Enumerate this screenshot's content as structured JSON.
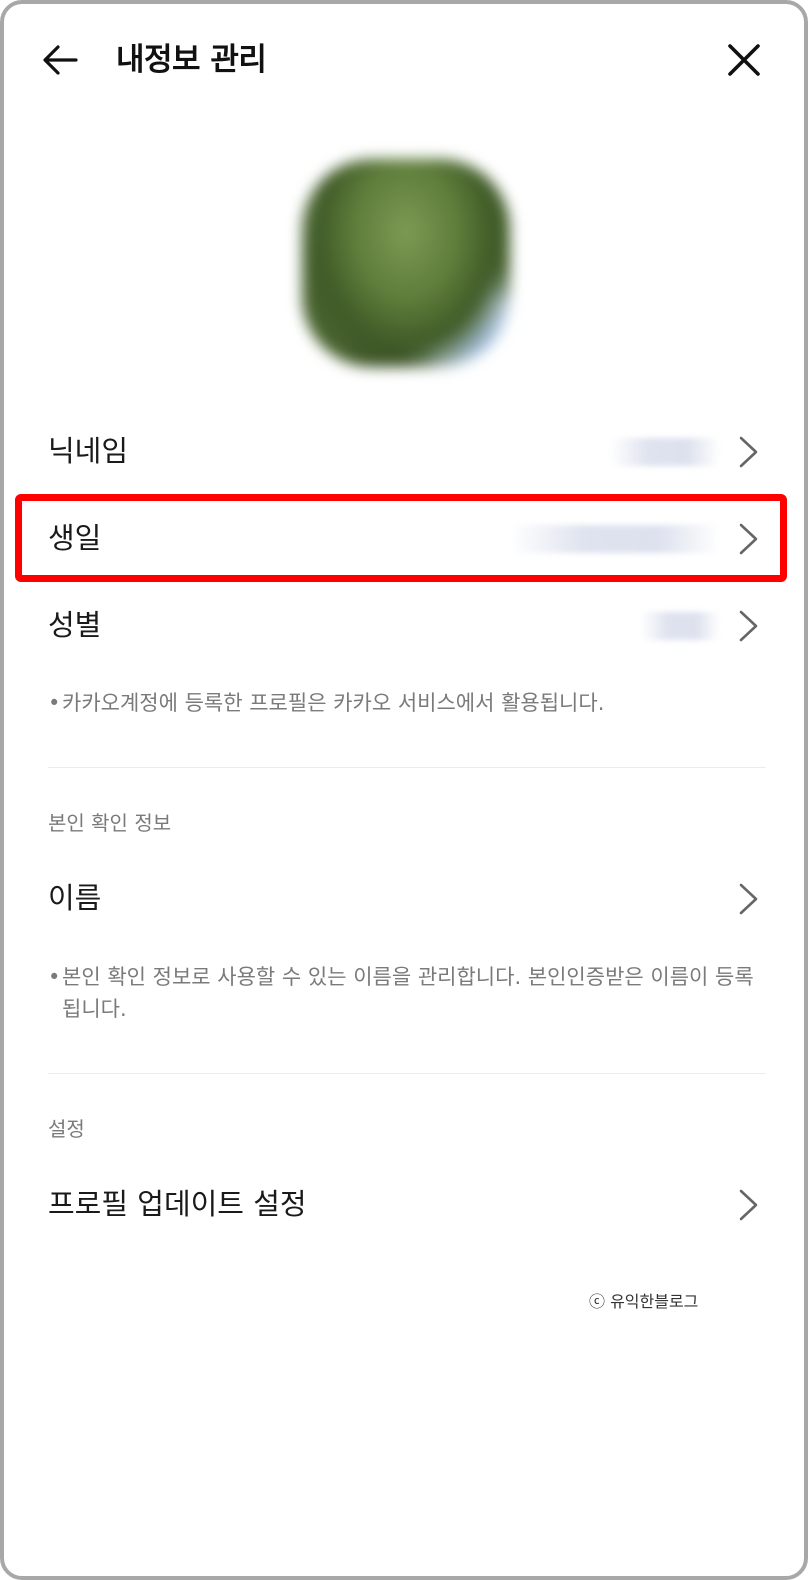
{
  "header": {
    "title": "내정보 관리",
    "back_icon": "arrow-left-icon",
    "close_icon": "close-icon"
  },
  "profile_rows": [
    {
      "label": "닉네임"
    },
    {
      "label": "생일"
    },
    {
      "label": "성별"
    }
  ],
  "profile_note": "카카오계정에 등록한 프로필은 카카오 서비스에서 활용됩니다.",
  "identity_section": {
    "title": "본인 확인 정보",
    "rows": [
      {
        "label": "이름"
      }
    ],
    "note": "본인 확인 정보로 사용할 수 있는 이름을 관리합니다. 본인인증받은 이름이 등록됩니다."
  },
  "settings_section": {
    "title": "설정",
    "rows": [
      {
        "label": "프로필 업데이트 설정"
      }
    ]
  },
  "watermark": "ⓒ 유익한블로그",
  "colors": {
    "highlight": "#ff0000",
    "text": "#1a1a1a",
    "muted": "#7a7a7a",
    "divider": "#ececec"
  }
}
